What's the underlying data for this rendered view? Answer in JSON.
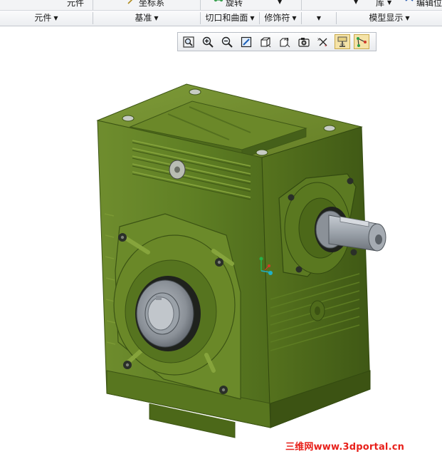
{
  "ribbon": {
    "top_row": {
      "component_label": "元件",
      "csys_label": "坐标系",
      "revolve_label": "旋转",
      "library_label": "库",
      "edit_position_label": "编辑位"
    },
    "groups": [
      {
        "label": "元件"
      },
      {
        "label": "基准"
      },
      {
        "label": "切口和曲面"
      },
      {
        "label": "修饰符"
      },
      {
        "label": ""
      },
      {
        "label": "模型显示"
      }
    ]
  },
  "view_toolbar": {
    "buttons": [
      {
        "icon": "refit-icon",
        "active": false
      },
      {
        "icon": "zoom-in-icon",
        "active": false
      },
      {
        "icon": "zoom-out-icon",
        "active": false
      },
      {
        "icon": "repaint-icon",
        "active": false
      },
      {
        "icon": "display-style-icon",
        "active": false
      },
      {
        "icon": "saved-orientations-icon",
        "active": false
      },
      {
        "icon": "view-manager-icon",
        "active": false
      },
      {
        "icon": "datum-display-icon",
        "active": false
      },
      {
        "icon": "spin-center-icon",
        "active": true
      },
      {
        "icon": "annotation-display-icon",
        "active": true
      }
    ]
  },
  "watermark": {
    "text": "三维网www.3dportal.cn"
  },
  "colors": {
    "model_green": "#5c7a20",
    "shaft_gray": "#9aa0a8",
    "watermark_red": "#e8201a",
    "active_button": "#f5e3a8"
  }
}
